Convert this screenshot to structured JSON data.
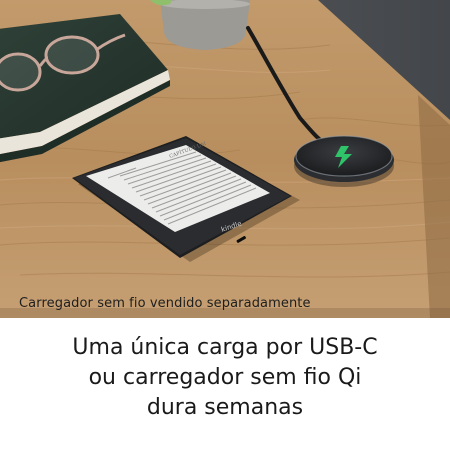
{
  "caption": "Carregador sem fio vendido separadamente",
  "headline": {
    "line1": "Uma única carga por USB-C",
    "line2": "ou carregador sem fio Qi",
    "line3": "dura semanas"
  },
  "device": {
    "brand": "kindle",
    "screen_title": "CAPÍTULO UM",
    "screen_text_lines": 14
  },
  "icons": {
    "charger": "lightning-bolt-icon"
  },
  "colors": {
    "wood": "#b98d5f",
    "bolt": "#2fc46a",
    "text": "#1a1a1a"
  }
}
